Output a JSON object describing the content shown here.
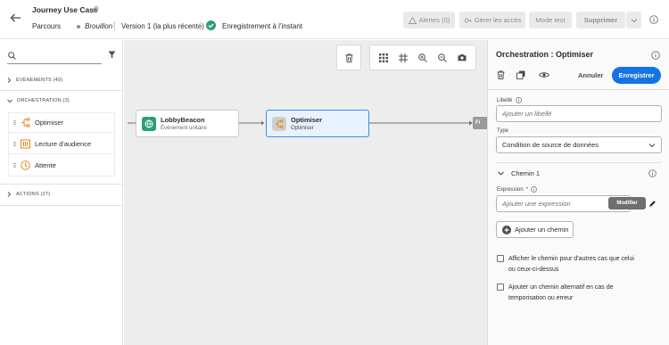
{
  "header": {
    "title": "Journey Use Case",
    "parcours": "Parcours",
    "status": "Brouillon",
    "version": "Version 1 (la plus récente)",
    "saved": "Enregistrement à l'instant",
    "buttons": {
      "alerts": "Alertes (0)",
      "access": "Gérer les accès",
      "test": "Mode test",
      "delete": "Supprimer"
    }
  },
  "left": {
    "sections": {
      "events": "ÉVÉNEMENTS (49)",
      "orchestration": "ORCHESTRATION (3)",
      "actions": "ACTIONS (27)"
    },
    "items": [
      "Optimiser",
      "Lecture d'audience",
      "Attente"
    ]
  },
  "canvas": {
    "node1": {
      "title": "LobbyBeacon",
      "sub": "Événement unitaire"
    },
    "node2": {
      "title": "Optimiser",
      "sub": "Optimiser"
    },
    "end": "Fi"
  },
  "right": {
    "title": "Orchestration : Optimiser",
    "cancel": "Annuler",
    "save": "Enregistrer",
    "label_title": "Libellé",
    "label_placeholder": "Ajouter un libellé",
    "type_title": "Type",
    "type_value": "Condition de source de données",
    "path_title": "Chemin 1",
    "expression_title": "Expression",
    "expression_placeholder": "Ajouter une expression",
    "tooltip": "Modifier",
    "add_path": "Ajouter un chemin",
    "chk1": "Afficher le chemin pour d'autres cas que celui ou ceux-ci-dessus",
    "chk2": "Ajouter un chemin alternatif en cas de temporisation ou erreur"
  },
  "colors": {
    "accent": "#1473e6",
    "saved_green": "#2d9d78",
    "canvas_bg": "#ededed"
  }
}
